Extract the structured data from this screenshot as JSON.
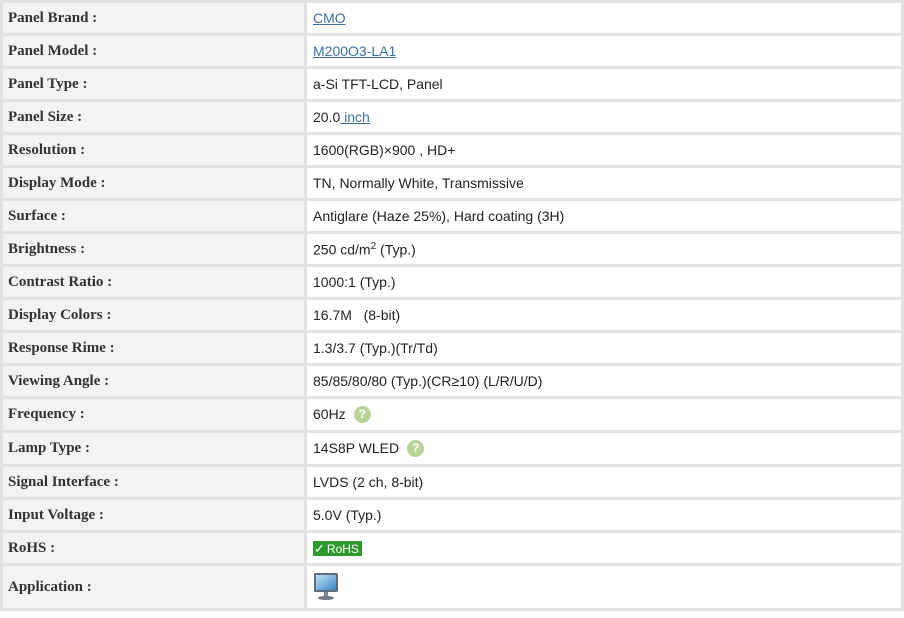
{
  "rows": [
    {
      "label": "Panel Brand :",
      "value": "CMO"
    },
    {
      "label": "Panel Model :",
      "value": "M200O3-LA1"
    },
    {
      "label": "Panel Type :",
      "value": "a-Si TFT-LCD, Panel"
    },
    {
      "label": "Panel Size :",
      "value": "20.0",
      "unit": " inch"
    },
    {
      "label": "Resolution :",
      "value": "1600(RGB)×900 , HD+"
    },
    {
      "label": "Display Mode :",
      "value": "TN, Normally White, Transmissive"
    },
    {
      "label": "Surface :",
      "value": "Antiglare (Haze 25%), Hard coating (3H)"
    },
    {
      "label": "Brightness :",
      "value": "250",
      "unit": " cd/m",
      "sup": "2",
      "suffix": " (Typ.)"
    },
    {
      "label": "Contrast Ratio :",
      "value": "1000:1 (Typ.)"
    },
    {
      "label": "Display Colors :",
      "value": "16.7M   (8-bit)"
    },
    {
      "label": "Response Rime :",
      "value": "1.3/3.7 (Typ.)(Tr/Td)"
    },
    {
      "label": "Viewing Angle :",
      "value": "85/85/80/80 (Typ.)(CR≥10) (L/R/U/D)"
    },
    {
      "label": "Frequency :",
      "value": "60Hz"
    },
    {
      "label": "Lamp Type :",
      "value": "14S8P WLED"
    },
    {
      "label": "Signal Interface :",
      "value": "LVDS (2 ch, 8-bit)"
    },
    {
      "label": "Input Voltage :",
      "value": "5.0V (Typ.)"
    },
    {
      "label": "RoHS :",
      "value": "RoHS",
      "icon": "check-icon"
    },
    {
      "label": "Application :",
      "icon": "monitor-icon"
    }
  ],
  "icons": {
    "help": "?"
  },
  "colors": {
    "link": "#3b6fa0",
    "rohs_badge": "#2e9a2e",
    "help_badge": "#b8d49a"
  }
}
